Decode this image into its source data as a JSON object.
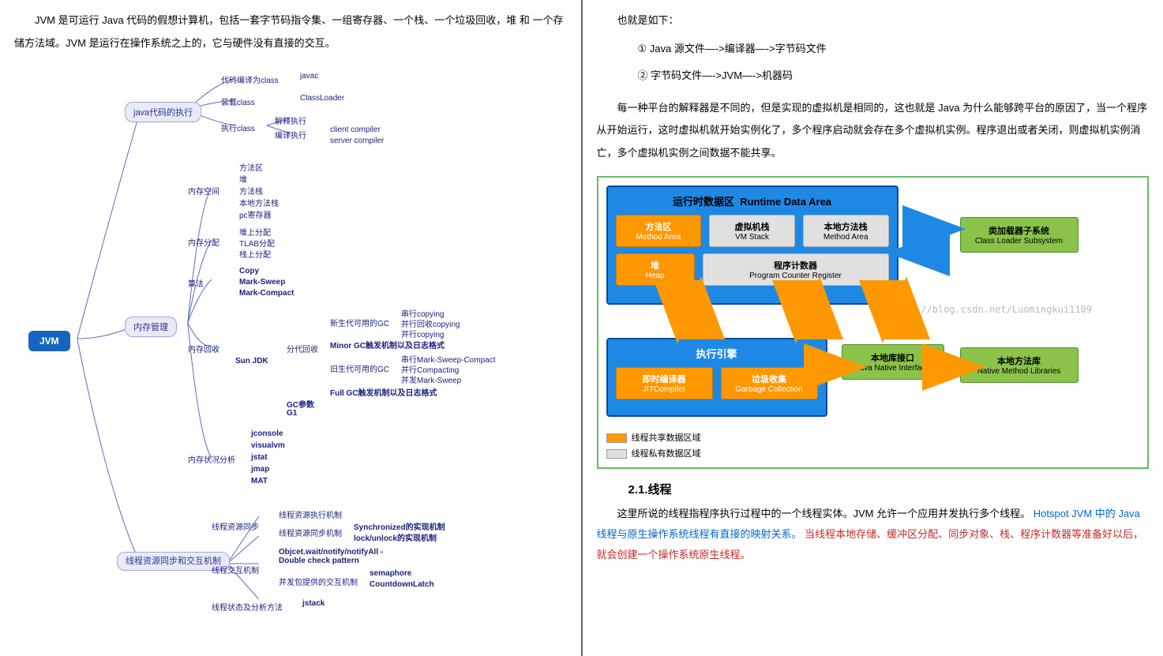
{
  "left": {
    "intro": "JVM 是可运行 Java 代码的假想计算机，包括一套字节码指令集、一组寄存器、一个栈、一个垃圾回收，堆 和 一个存储方法域。JVM 是运行在操作系统之上的，它与硬件没有直接的交互。",
    "root": "JVM",
    "n1": "java代码的执行",
    "n1a": "代码编译为class",
    "n1a1": "javac",
    "n1b": "装载class",
    "n1b1": "ClassLoader",
    "n1c": "执行class",
    "n1c1": "解释执行",
    "n1c2": "编译执行",
    "n1c2a": "client compiler",
    "n1c2b": "server compiler",
    "n2": "内存管理",
    "n2a": "内存空间",
    "n2a1": "方法区",
    "n2a2": "堆",
    "n2a3": "方法栈",
    "n2a4": "本地方法栈",
    "n2a5": "pc寄存器",
    "n2b": "内存分配",
    "n2b1": "堆上分配",
    "n2b2": "TLAB分配",
    "n2b3": "栈上分配",
    "n2c": "算法",
    "n2c1": "Copy",
    "n2c2": "Mark-Sweep",
    "n2c3": "Mark-Compact",
    "n2d": "内存回收",
    "n2d1": "Sun JDK",
    "n2d2": "分代回收",
    "n2d2a": "新生代可用的GC",
    "n2d2a1": "串行copying",
    "n2d2a2": "并行回收copying",
    "n2d2a3": "并行copying",
    "n2d2b": "Minor GC触发机制以及日志格式",
    "n2d2c": "旧生代可用的GC",
    "n2d2c1": "串行Mark-Sweep-Compact",
    "n2d2c2": "并行Compacting",
    "n2d2c3": "并发Mark-Sweep",
    "n2d2d": "Full GC触发机制以及日志格式",
    "n2d3": "GC参数",
    "n2d4": "G1",
    "n2e": "内存状况分析",
    "n2e1": "jconsole",
    "n2e2": "visualvm",
    "n2e3": "jstat",
    "n2e4": "jmap",
    "n2e5": "MAT",
    "n3": "线程资源同步和交互机制",
    "n3a": "线程资源同步",
    "n3a1": "线程资源执行机制",
    "n3a2": "线程资源同步机制",
    "n3a2a": "Synchronized的实现机制",
    "n3a2b": "lock/unlock的实现机制",
    "n3b": "线程交互机制",
    "n3b1": "Objcet.wait/notify/notifyAll - Double check pattern",
    "n3b2": "并发包提供的交互机制",
    "n3b2a": "semaphore",
    "n3b2b": "CountdownLatch",
    "n3c": "线程状态及分析方法",
    "n3c1": "jstack"
  },
  "right": {
    "p0": "也就是如下：",
    "p1": "① Java 源文件—->编译器—->字节码文件",
    "p2": "② 字节码文件—->JVM—->机器码",
    "p3": "每一种平台的解释器是不同的，但是实现的虚拟机是相同的，这也就是 Java 为什么能够跨平台的原因了，当一个程序从开始运行，这时虚拟机就开始实例化了，多个程序启动就会存在多个虚拟机实例。程序退出或者关闭，则虚拟机实例消亡，多个虚拟机实例之间数据不能共享。",
    "diag": {
      "rt_title_cn": "运行时数据区",
      "rt_title_en": "Runtime Data Area",
      "method_area_cn": "方法区",
      "method_area_en": "Method Area",
      "vm_stack_cn": "虚拟机栈",
      "vm_stack_en": "VM Stack",
      "native_ma_cn": "本地方法栈",
      "native_ma_en": "Method Area",
      "heap_cn": "堆",
      "heap_en": "Heap",
      "pc_cn": "程序计数器",
      "pc_en": "Program Counter Register",
      "exec_title": "执行引擎",
      "jit_cn": "即时编译器",
      "jit_en": "JITCompiler",
      "gc_cn": "垃圾收集",
      "gc_en": "Garbage Collection",
      "cls_cn": "类加载器子系统",
      "cls_en": "Class Loader Subsystem",
      "jni_cn": "本地库接口",
      "jni_en": "Java Native Interface",
      "nml_cn": "本地方法库",
      "nml_en": "Native Method Libraries",
      "wm": "http://blog.csdn.net/Luomingkui1109",
      "legend1": "线程共享数据区域",
      "legend2": "线程私有数据区域"
    },
    "h2": "2.1.线程",
    "p4a": "这里所说的线程指程序执行过程中的一个线程实体。JVM 允许一个应用并发执行多个线程。",
    "p4b": "Hotspot JVM 中的 Java 线程与原生操作系统线程有直接的映射关系。",
    "p4c": "当线程本地存储、缓冲区分配、同步对象、栈、程序计数器等准备好以后，就会创建一个操作系统原生线程。"
  }
}
